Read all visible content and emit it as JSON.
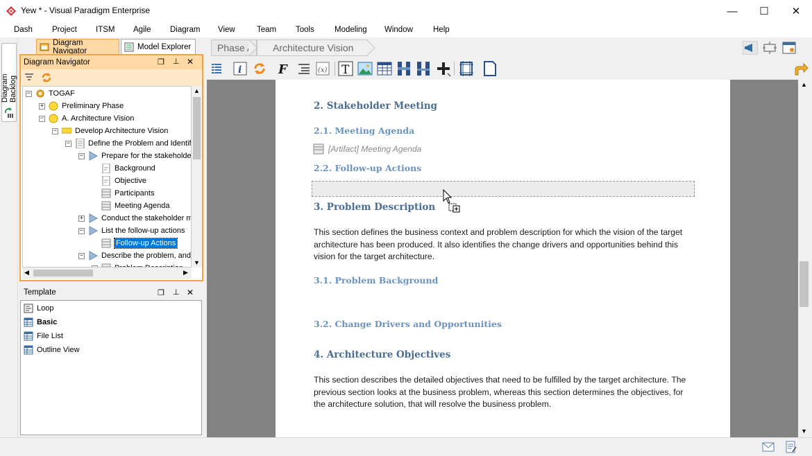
{
  "window": {
    "title": "Yew * - Visual Paradigm Enterprise",
    "minimize_glyph": "—",
    "maximize_glyph": "☐",
    "close_glyph": "✕"
  },
  "menu": [
    "Dash",
    "Project",
    "ITSM",
    "Agile",
    "Diagram",
    "View",
    "Team",
    "Tools",
    "Modeling",
    "Window",
    "Help"
  ],
  "side_strip": {
    "label": "Diagram Backlog"
  },
  "left_tabs": {
    "diagram_navigator": "Diagram Navigator",
    "model_explorer": "Model Explorer"
  },
  "navigator": {
    "title": "Diagram Navigator",
    "tree": [
      {
        "label": "TOGAF",
        "level": 0,
        "exp": "−",
        "icon": "togaf-gear-icon"
      },
      {
        "label": "Preliminary Phase",
        "level": 1,
        "exp": "+",
        "icon": "yellow-circle-icon"
      },
      {
        "label": "A. Architecture Vision",
        "level": 1,
        "exp": "−",
        "icon": "yellow-circle-icon"
      },
      {
        "label": "Develop Architecture Vision",
        "level": 2,
        "exp": "−",
        "icon": "yellow-bar-icon"
      },
      {
        "label": "Define the Problem and Identify",
        "level": 3,
        "exp": "−",
        "icon": "document-icon"
      },
      {
        "label": "Prepare for the stakeholde",
        "level": 4,
        "exp": "−",
        "icon": "triangle-step-icon"
      },
      {
        "label": "Background",
        "level": 5,
        "exp": "",
        "icon": "text-page-icon"
      },
      {
        "label": "Objective",
        "level": 5,
        "exp": "",
        "icon": "text-page-icon"
      },
      {
        "label": "Participants",
        "level": 5,
        "exp": "",
        "icon": "artifact-icon"
      },
      {
        "label": "Meeting Agenda",
        "level": 5,
        "exp": "",
        "icon": "artifact-icon"
      },
      {
        "label": "Conduct the stakeholder m",
        "level": 4,
        "exp": "+",
        "icon": "triangle-step-icon"
      },
      {
        "label": "List the follow-up actions",
        "level": 4,
        "exp": "−",
        "icon": "triangle-step-icon"
      },
      {
        "label": "Follow-up Actions",
        "level": 5,
        "exp": "",
        "icon": "artifact-icon",
        "selected": true
      },
      {
        "label": "Describe the problem, and",
        "level": 4,
        "exp": "−",
        "icon": "triangle-step-icon"
      },
      {
        "label": "Problem Description",
        "level": 5,
        "exp": "−",
        "icon": "artifact-icon"
      }
    ]
  },
  "template_panel": {
    "title": "Template",
    "items": [
      {
        "label": "Loop",
        "bold": false,
        "icon": "loop-template-icon"
      },
      {
        "label": "Basic",
        "bold": true,
        "icon": "table-template-icon"
      },
      {
        "label": "File List",
        "bold": false,
        "icon": "table-template-icon"
      },
      {
        "label": "Outline View",
        "bold": false,
        "icon": "table-template-icon"
      }
    ]
  },
  "breadcrumb": [
    "Phase A",
    "Architecture Vision"
  ],
  "document": {
    "h_stakeholder": "2. Stakeholder Meeting",
    "h_agenda": "2.1. Meeting Agenda",
    "artifact_ref": "[Artifact] Meeting Agenda",
    "h_followup": "2.2. Follow-up Actions",
    "h_problem": "3. Problem Description",
    "p_problem": "This section defines the business context and problem description for which the vision of the target architecture has been produced. It also identifies the change drivers and opportunities behind this vision for the target architecture.",
    "h_background": "3.1. Problem Background",
    "h_drivers": "3.2. Change Drivers and Opportunities",
    "h_objectives": "4. Architecture Objectives",
    "p_objectives": "This section describes the detailed objectives that need to be fulfilled by the target architecture. The previous section looks at the business problem, whereas this section determines the objectives, for the architecture solution, that will resolve the business problem."
  },
  "colors": {
    "heading": "#4a6d94",
    "subheading": "#6b93bf",
    "panel_accent": "#f0a447",
    "selection": "#0078d7"
  }
}
